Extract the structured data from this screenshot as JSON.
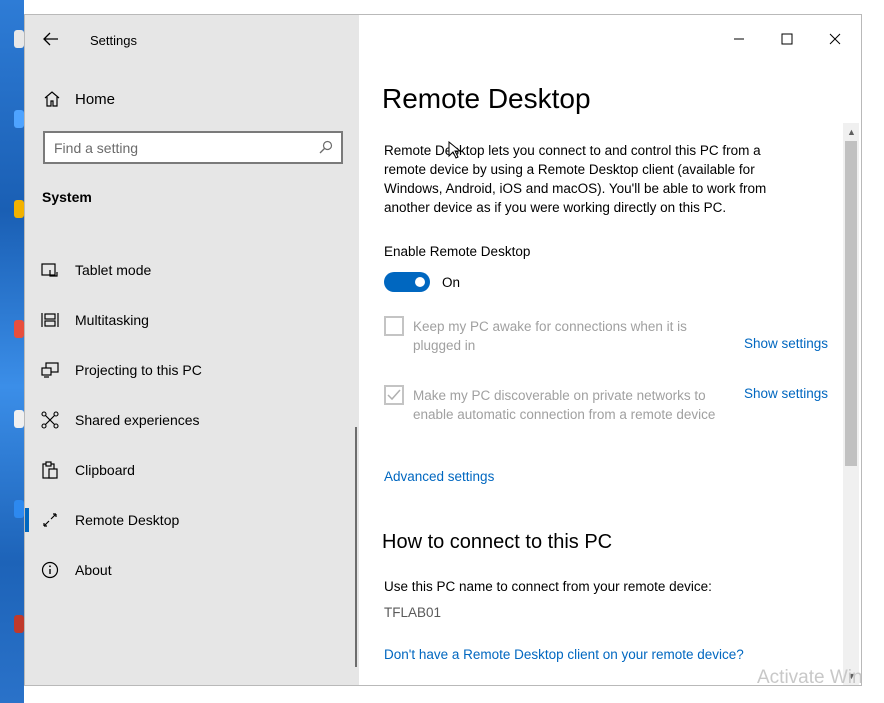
{
  "window": {
    "app_title": "Settings",
    "controls": [
      "minimize",
      "maximize",
      "close"
    ]
  },
  "sidebar": {
    "home_label": "Home",
    "search_placeholder": "Find a setting",
    "section_title": "System",
    "items": [
      {
        "label": "Tablet mode",
        "icon": "tablet-mode-icon"
      },
      {
        "label": "Multitasking",
        "icon": "multitasking-icon"
      },
      {
        "label": "Projecting to this PC",
        "icon": "projecting-icon"
      },
      {
        "label": "Shared experiences",
        "icon": "shared-experiences-icon"
      },
      {
        "label": "Clipboard",
        "icon": "clipboard-icon"
      },
      {
        "label": "Remote Desktop",
        "icon": "remote-desktop-icon",
        "active": true
      },
      {
        "label": "About",
        "icon": "info-icon"
      }
    ]
  },
  "main": {
    "title": "Remote Desktop",
    "description": "Remote Desktop lets you connect to and control this PC from a remote device by using a Remote Desktop client (available for Windows, Android, iOS and macOS). You'll be able to work from another device as if you were working directly on this PC.",
    "enable_label": "Enable Remote Desktop",
    "toggle_state": "On",
    "keep_awake": {
      "label": "Keep my PC awake for connections when it is plugged in",
      "checked": false,
      "link": "Show settings"
    },
    "discoverable": {
      "label": "Make my PC discoverable on private networks to enable automatic connection from a remote device",
      "checked": true,
      "link": "Show settings"
    },
    "advanced_link": "Advanced settings",
    "connect_heading": "How to connect to this PC",
    "use_name_label": "Use this PC name to connect from your remote device:",
    "pc_name": "TFLAB01",
    "client_link": "Don't have a Remote Desktop client on your remote device?",
    "watermark": "Activate Win"
  },
  "colors": {
    "accent": "#0067c0",
    "sidebar_bg": "#e6e6e6",
    "disabled_text": "#a0a0a0"
  }
}
